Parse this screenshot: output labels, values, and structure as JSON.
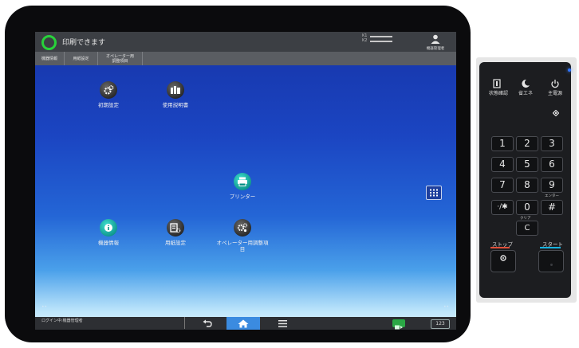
{
  "statusbar": {
    "status_text": "印刷できます",
    "k1": "K1",
    "k2": "K2",
    "admin_label": "機器管理者"
  },
  "tabs": [
    {
      "label": "機器情報"
    },
    {
      "label": "用紙設定"
    },
    {
      "label": "オペレーター用\n調整項目"
    }
  ],
  "apps": [
    {
      "label": "初期設定",
      "icon": "gear-icon"
    },
    {
      "label": "使用説明書",
      "icon": "manual-icon"
    },
    {
      "label": "プリンター",
      "icon": "printer-icon"
    },
    {
      "label": "機器情報",
      "icon": "info-icon"
    },
    {
      "label": "用紙設定",
      "icon": "paper-settings-icon"
    },
    {
      "label": "オペレーター用調整項\n目",
      "icon": "operator-settings-icon"
    }
  ],
  "bottombar": {
    "login_text": "ログイン中:機器管理者",
    "num_badge": "123"
  },
  "panel": {
    "status_check": "状態確認",
    "energy_saver": "省エネ",
    "main_power": "主電源",
    "keys": [
      "1",
      "2",
      "3",
      "4",
      "5",
      "6",
      "7",
      "8",
      "9",
      "·/✱",
      "0",
      "#"
    ],
    "enter_label": "エンター",
    "clear_sub": "クリア",
    "clear_key": "C",
    "stop_label": "ストップ",
    "start_label": "スタート"
  },
  "colors": {
    "status_ring": "#28d23a",
    "stop_accent": "#e0503a",
    "start_accent": "#18b3e0"
  }
}
